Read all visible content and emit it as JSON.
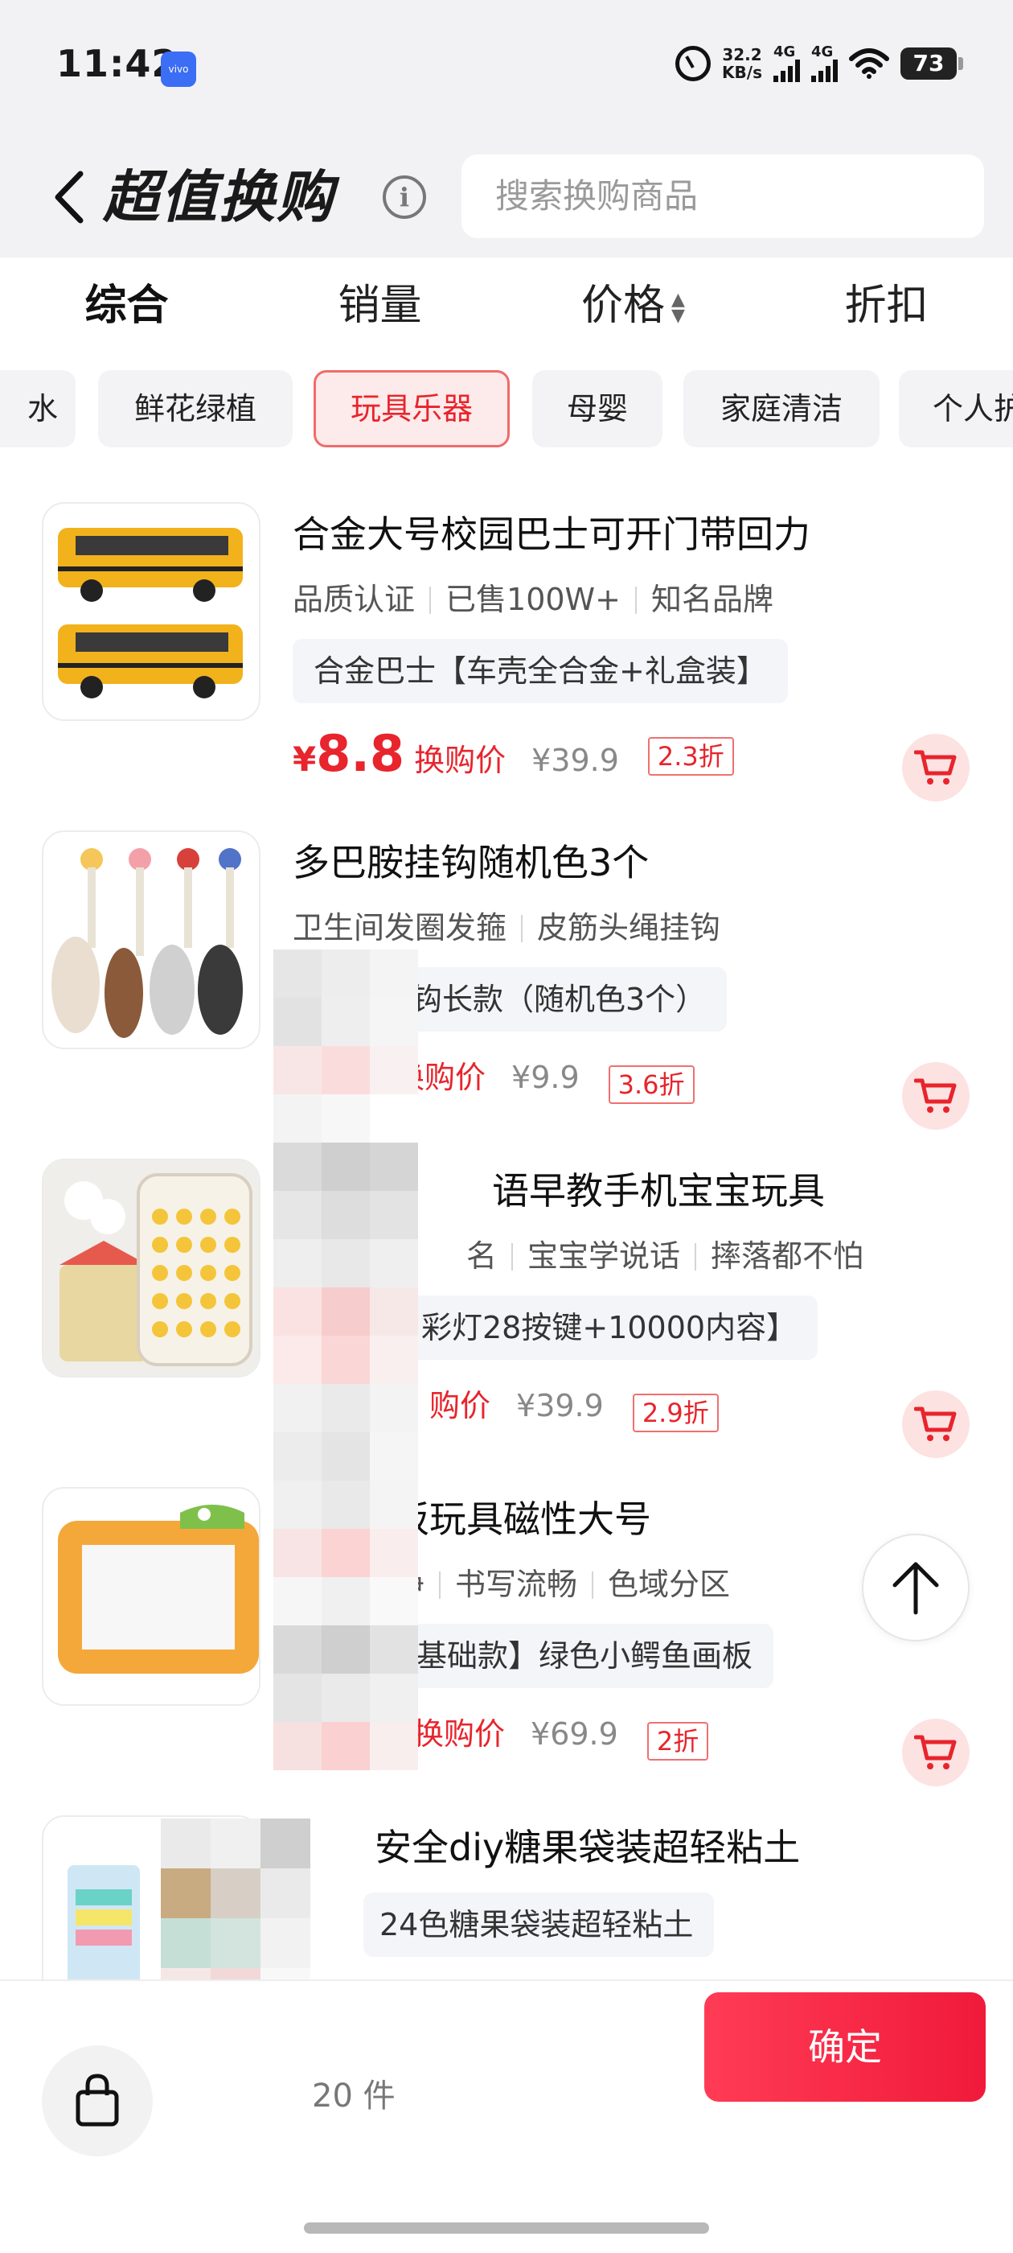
{
  "status_bar": {
    "time": "11:42",
    "speed_value": "32.2",
    "speed_unit": "KB/s",
    "signal1": "4G",
    "signal2": "4G",
    "battery": "73"
  },
  "header": {
    "title": "超值换购",
    "search_placeholder": "搜索换购商品"
  },
  "sort_tabs": [
    {
      "label": "综合"
    },
    {
      "label": "销量"
    },
    {
      "label": "价格"
    },
    {
      "label": "折扣"
    }
  ],
  "categories": [
    {
      "label": "水"
    },
    {
      "label": "鲜花绿植"
    },
    {
      "label": "玩具乐器"
    },
    {
      "label": "母婴"
    },
    {
      "label": "家庭清洁"
    },
    {
      "label": "个人护"
    }
  ],
  "products": [
    {
      "title": "合金大号校园巴士可开门带回力",
      "tags": [
        "品质认证",
        "已售100W+",
        "知名品牌"
      ],
      "spec": "合金巴士【车壳全合金+礼盒装】",
      "currency": "¥",
      "price": "8.8",
      "price_label": "换购价",
      "original_price": "¥39.9",
      "discount": "2.3折"
    },
    {
      "title": "多巴胺挂钩随机色3个",
      "tags": [
        "卫生间发圈发箍",
        "皮筋头绳挂钩"
      ],
      "spec": "挂钩长款（随机色3个）",
      "price_label": "换购价",
      "original_price": "¥9.9",
      "discount": "3.6折"
    },
    {
      "title": "语早教手机宝宝玩具",
      "tags": [
        "名",
        "宝宝学说话",
        "摔落都不怕"
      ],
      "spec": "彩灯28按键+10000内容】",
      "price_label": "购价",
      "original_price": "¥39.9",
      "discount": "2.9折"
    },
    {
      "title": "板玩具磁性大号",
      "tags": [
        "净",
        "书写流畅",
        "色域分区"
      ],
      "spec": "【基础款】绿色小鳄鱼画板",
      "price": "3",
      "price_label": "换购价",
      "original_price": "¥69.9",
      "discount": "2折"
    },
    {
      "title": "安全diy糖果袋装超轻粘土",
      "spec": "24色糖果袋装超轻粘土"
    }
  ],
  "bottom_bar": {
    "count_text": "20 件",
    "confirm_label": "确定"
  },
  "colors": {
    "accent": "#e8242c",
    "confirm_button": "#f5213f",
    "chip_active_bg": "#fdeaea",
    "page_bg_top": "#f2f2f4"
  },
  "icons": [
    "back-icon",
    "info-icon",
    "sort-arrows-icon",
    "cart-icon",
    "arrow-up-icon",
    "shopping-bag-icon",
    "alarm-icon",
    "wifi-icon",
    "battery-icon"
  ]
}
